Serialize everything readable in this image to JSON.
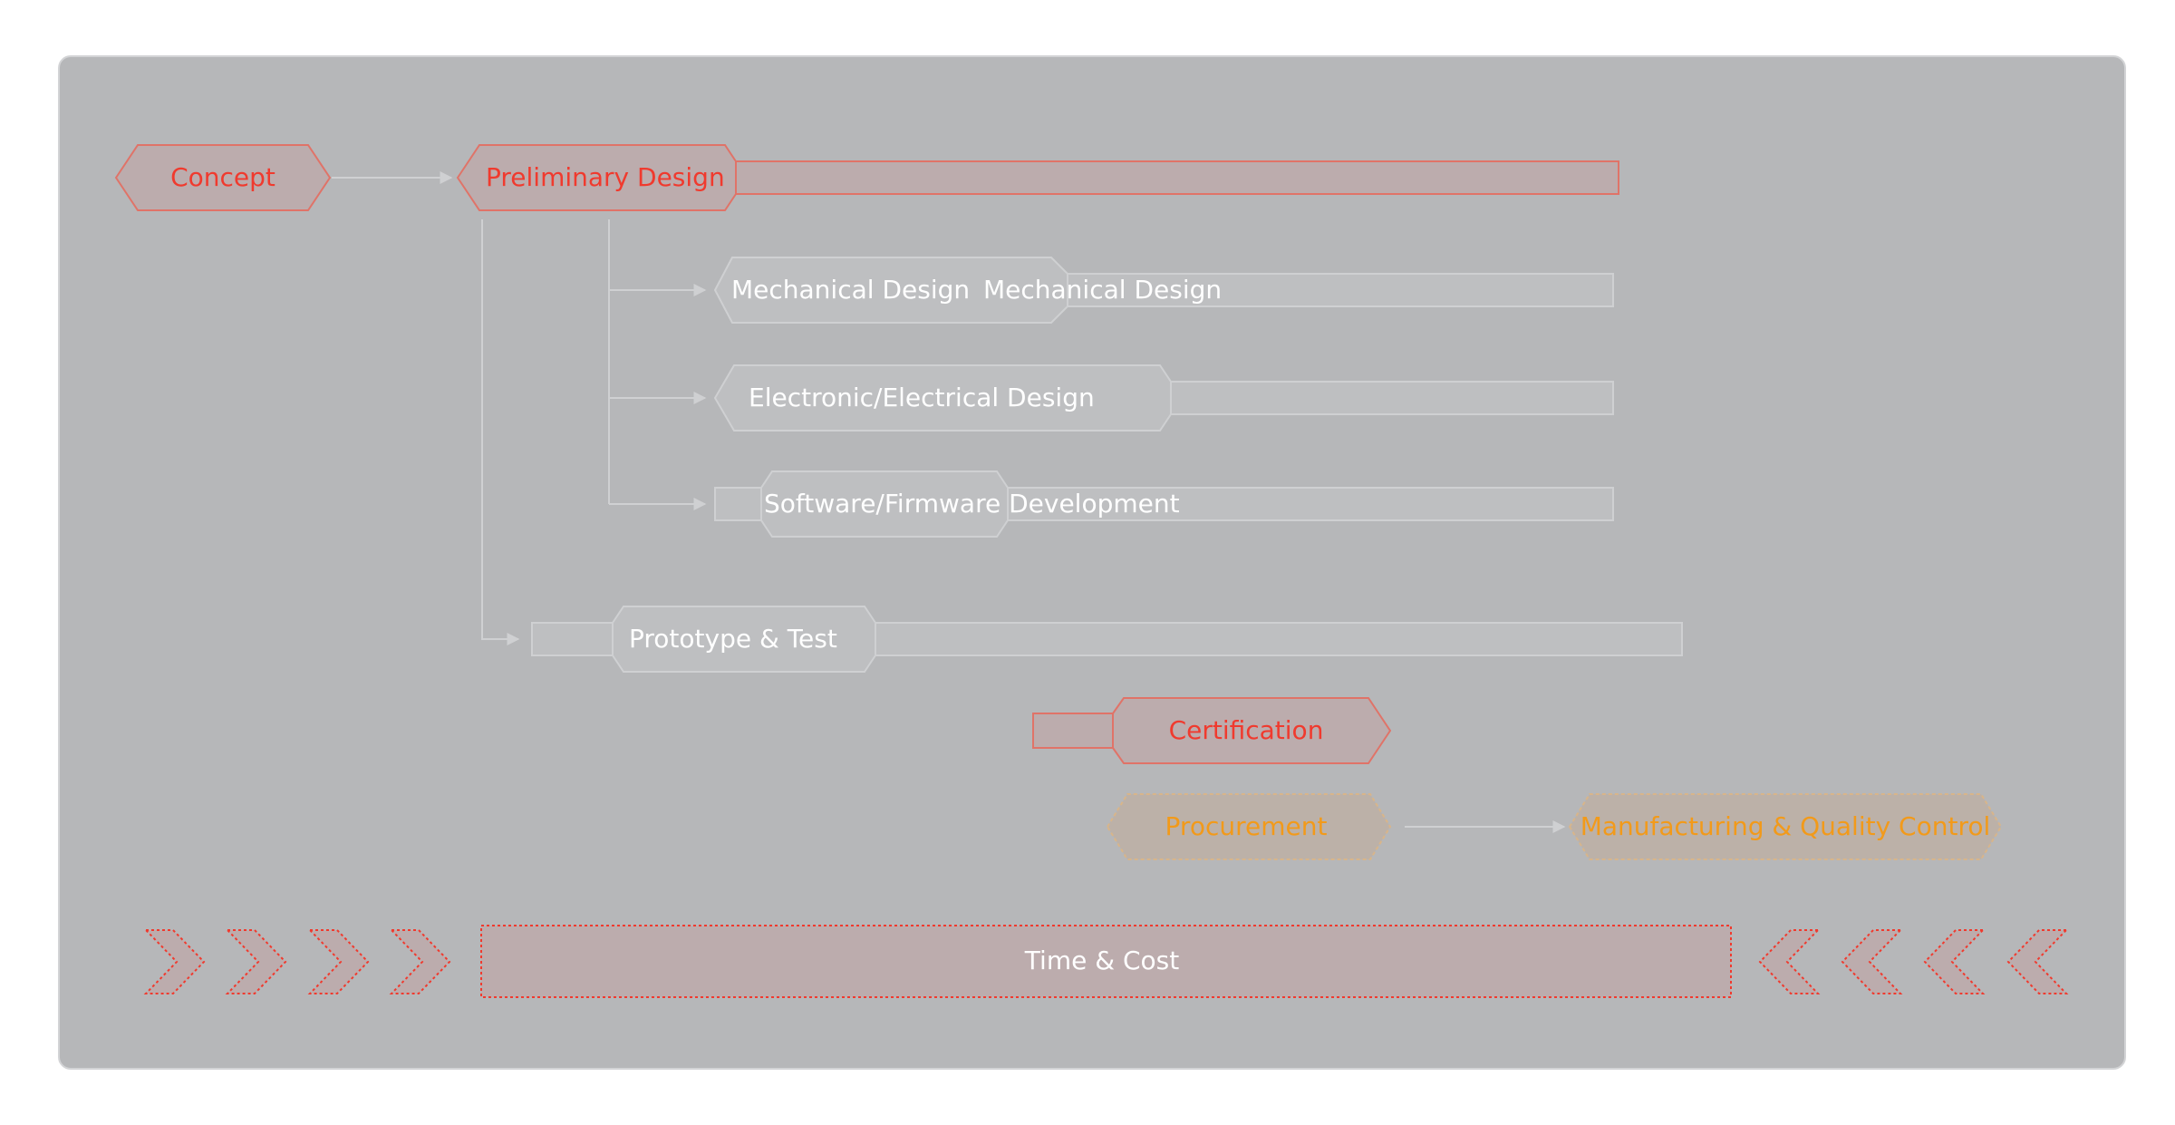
{
  "colors": {
    "red": "#f03a2e",
    "orange": "#f29a1a",
    "white": "#ffffff",
    "panel": "#b6b7b9",
    "red_fill": "#bcacad",
    "grey_fill": "#bebfc1",
    "connector": "#cfd0d2"
  },
  "nodes": {
    "concept": "Concept",
    "preliminary_design": "Preliminary Design",
    "mechanical_design_1": "Mechanical Design",
    "mechanical_design_2": "Mechanical Design",
    "electrical_design": "Electronic/Electrical Design",
    "software_dev": "Software/Firmware Development",
    "prototype_test": "Prototype & Test",
    "certification": "Certification",
    "procurement": "Procurement",
    "manufacturing": "Manufacturing & Quality Control"
  },
  "footer": {
    "time_cost": "Time & Cost",
    "left_chevron_icon": "chevron-right-icon",
    "right_chevron_icon": "chevron-left-icon"
  }
}
